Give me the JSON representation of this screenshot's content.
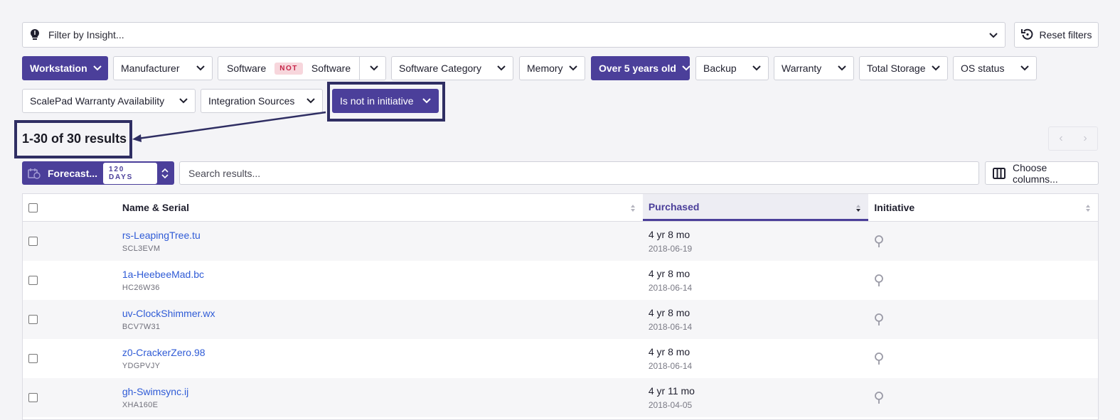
{
  "insight_filter": {
    "placeholder": "Filter by Insight..."
  },
  "reset_filters_label": "Reset filters",
  "filters_row1": [
    {
      "label": "Workstation",
      "active": true
    },
    {
      "label": "Manufacturer",
      "active": false
    },
    {
      "label": "Software",
      "active": false
    },
    {
      "label": "Software Category",
      "active": false
    },
    {
      "label": "Memory",
      "active": false
    },
    {
      "label": "Over 5 years old",
      "active": true
    },
    {
      "label": "Backup",
      "active": false
    },
    {
      "label": "Warranty",
      "active": false
    },
    {
      "label": "Total Storage",
      "active": false
    },
    {
      "label": "OS status",
      "active": false
    }
  ],
  "software_not_filter": {
    "label": "Software",
    "operator": "NOT",
    "value": "Software"
  },
  "filters_row2": [
    {
      "label": "ScalePad Warranty Availability",
      "active": false
    },
    {
      "label": "Integration Sources",
      "active": false
    },
    {
      "label": "Is not in initiative",
      "active": true
    }
  ],
  "results_summary": "1-30 of 30 results",
  "forecast": {
    "label": "Forecast...",
    "days": "120 DAYS"
  },
  "search": {
    "placeholder": "Search results..."
  },
  "choose_columns_label": "Choose columns...",
  "table": {
    "columns": [
      "Name & Serial",
      "Purchased",
      "Initiative"
    ],
    "rows": [
      {
        "name": "rs-LeapingTree.tu",
        "serial": "SCL3EVM",
        "purchased": "4 yr 8 mo",
        "date": "2018-06-19"
      },
      {
        "name": "1a-HeebeeMad.bc",
        "serial": "HC26W36",
        "purchased": "4 yr 8 mo",
        "date": "2018-06-14"
      },
      {
        "name": "uv-ClockShimmer.wx",
        "serial": "BCV7W31",
        "purchased": "4 yr 8 mo",
        "date": "2018-06-14"
      },
      {
        "name": "z0-CrackerZero.98",
        "serial": "YDGPVJY",
        "purchased": "4 yr 8 mo",
        "date": "2018-06-14"
      },
      {
        "name": "gh-Swimsync.ij",
        "serial": "XHA160E",
        "purchased": "4 yr 11 mo",
        "date": "2018-04-05"
      }
    ]
  },
  "colors": {
    "accent": "#4b3f9a",
    "link": "#2f5bd6",
    "annotation": "#2f2e63",
    "not_badge": "#c52447"
  }
}
